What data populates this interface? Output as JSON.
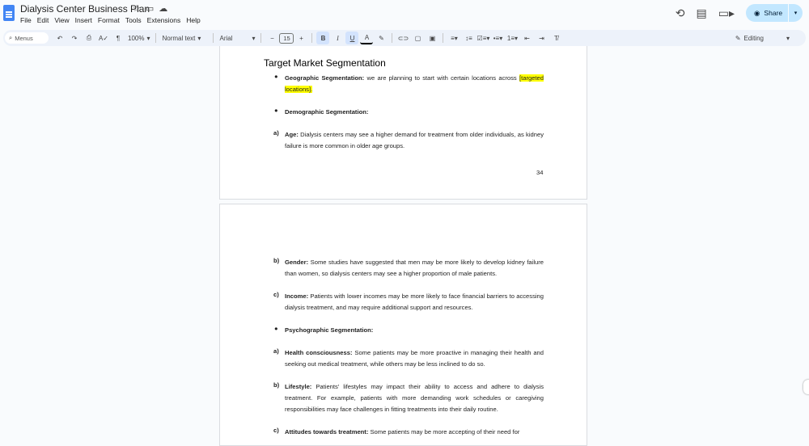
{
  "window": {
    "doc_title": "Dialysis Center Business Plan",
    "menu": [
      "File",
      "Edit",
      "View",
      "Insert",
      "Format",
      "Tools",
      "Extensions",
      "Help"
    ],
    "share_label": "Share"
  },
  "toolbar": {
    "search_label": "Menus",
    "zoom": "100%",
    "style": "Normal text",
    "font": "Arial",
    "font_size": "15",
    "mode": "Editing",
    "icons": [
      "undo-icon",
      "redo-icon",
      "print-icon",
      "spellcheck-icon",
      "paint-format-icon",
      "bold-icon",
      "italic-icon",
      "underline-icon",
      "text-color-icon",
      "highlight-icon",
      "link-icon",
      "comment-icon",
      "image-icon",
      "align-icon",
      "line-spacing-icon",
      "checklist-icon",
      "bullet-list-icon",
      "numbered-list-icon",
      "decrease-indent-icon",
      "increase-indent-icon",
      "clear-format-icon"
    ]
  },
  "page1": {
    "heading": "Target Market Segmentation",
    "geo_label": "Geographic Segmentation:",
    "geo_text": " we are planning to start with certain locations across",
    "geo_highlight": "[targeted locations].",
    "demo_label": "Demographic Segmentation:",
    "age_marker": "a)",
    "age_label": "Age:",
    "age_text": " Dialysis centers may see a higher demand for treatment from older individuals, as kidney failure is more common in older age groups.",
    "page_number": "34"
  },
  "page2": {
    "gender_marker": "b)",
    "gender_label": "Gender:",
    "gender_text": " Some studies have suggested that men may be more likely to develop kidney failure than women, so dialysis centers may see a higher proportion of male patients.",
    "income_marker": "c)",
    "income_label": "Income:",
    "income_text": " Patients with lower incomes may be more likely to face financial barriers to accessing dialysis treatment, and may require additional support and resources.",
    "psycho_label": "Psychographic Segmentation:",
    "health_marker": "a)",
    "health_label": "Health consciousness:",
    "health_text": " Some patients may be more proactive in managing their health and seeking out medical treatment, while others may be less inclined to do so.",
    "life_marker": "b)",
    "life_label": "Lifestyle:",
    "life_text": " Patients' lifestyles may impact their ability to access and adhere to dialysis treatment. For example, patients with more demanding work schedules or caregiving responsibilities may face challenges in fitting treatments into their daily routine.",
    "att_marker": "c)",
    "att_label": "Attitudes towards treatment:",
    "att_text": " Some patients may be more accepting of their need for"
  }
}
